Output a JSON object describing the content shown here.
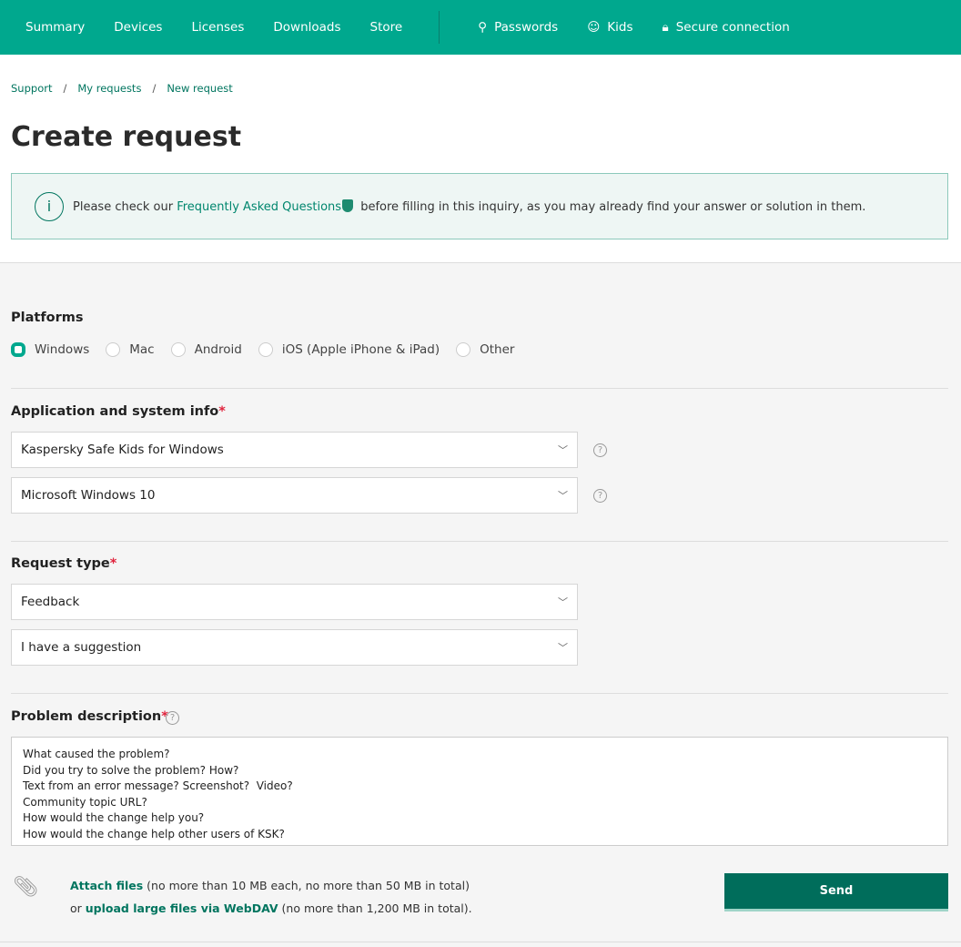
{
  "nav": {
    "items": [
      "Summary",
      "Devices",
      "Licenses",
      "Downloads",
      "Store"
    ],
    "right": [
      {
        "label": "Passwords",
        "icon": "key-icon"
      },
      {
        "label": "Kids",
        "icon": "kids-icon"
      },
      {
        "label": "Secure connection",
        "icon": "lock-icon"
      }
    ]
  },
  "breadcrumb": [
    "Support",
    "My requests",
    "New request"
  ],
  "title": "Create request",
  "info": {
    "before": "Please check our ",
    "link": "Frequently Asked Questions",
    "after": " before filling in this inquiry, as you may already find your answer or solution in them."
  },
  "platforms": {
    "label": "Platforms",
    "options": [
      "Windows",
      "Mac",
      "Android",
      "iOS (Apple iPhone & iPad)",
      "Other"
    ],
    "selected": "Windows"
  },
  "app_info": {
    "label": "Application and system info",
    "required": "*",
    "application": "Kaspersky Safe Kids for Windows",
    "os": "Microsoft Windows 10"
  },
  "request_type": {
    "label": "Request type",
    "required": "*",
    "type": "Feedback",
    "subtype": "I have a suggestion"
  },
  "description": {
    "label": "Problem description",
    "required": "*",
    "value": "What caused the problem?\nDid you try to solve the problem? How?\nText from an error message? Screenshot?  Video?\nCommunity topic URL?\nHow would the change help you?\nHow would the change help other users of KSK?"
  },
  "attach": {
    "link1": "Attach files",
    "text1": " (no more than 10 MB each, no more than 50 MB in total)",
    "or": "or ",
    "link2": "upload large files via WebDAV",
    "text2": " (no more than 1,200 MB in total)."
  },
  "send_label": "Send",
  "help_glyph": "?",
  "colors": {
    "brand": "#00a88e",
    "dark": "#006d5b"
  }
}
